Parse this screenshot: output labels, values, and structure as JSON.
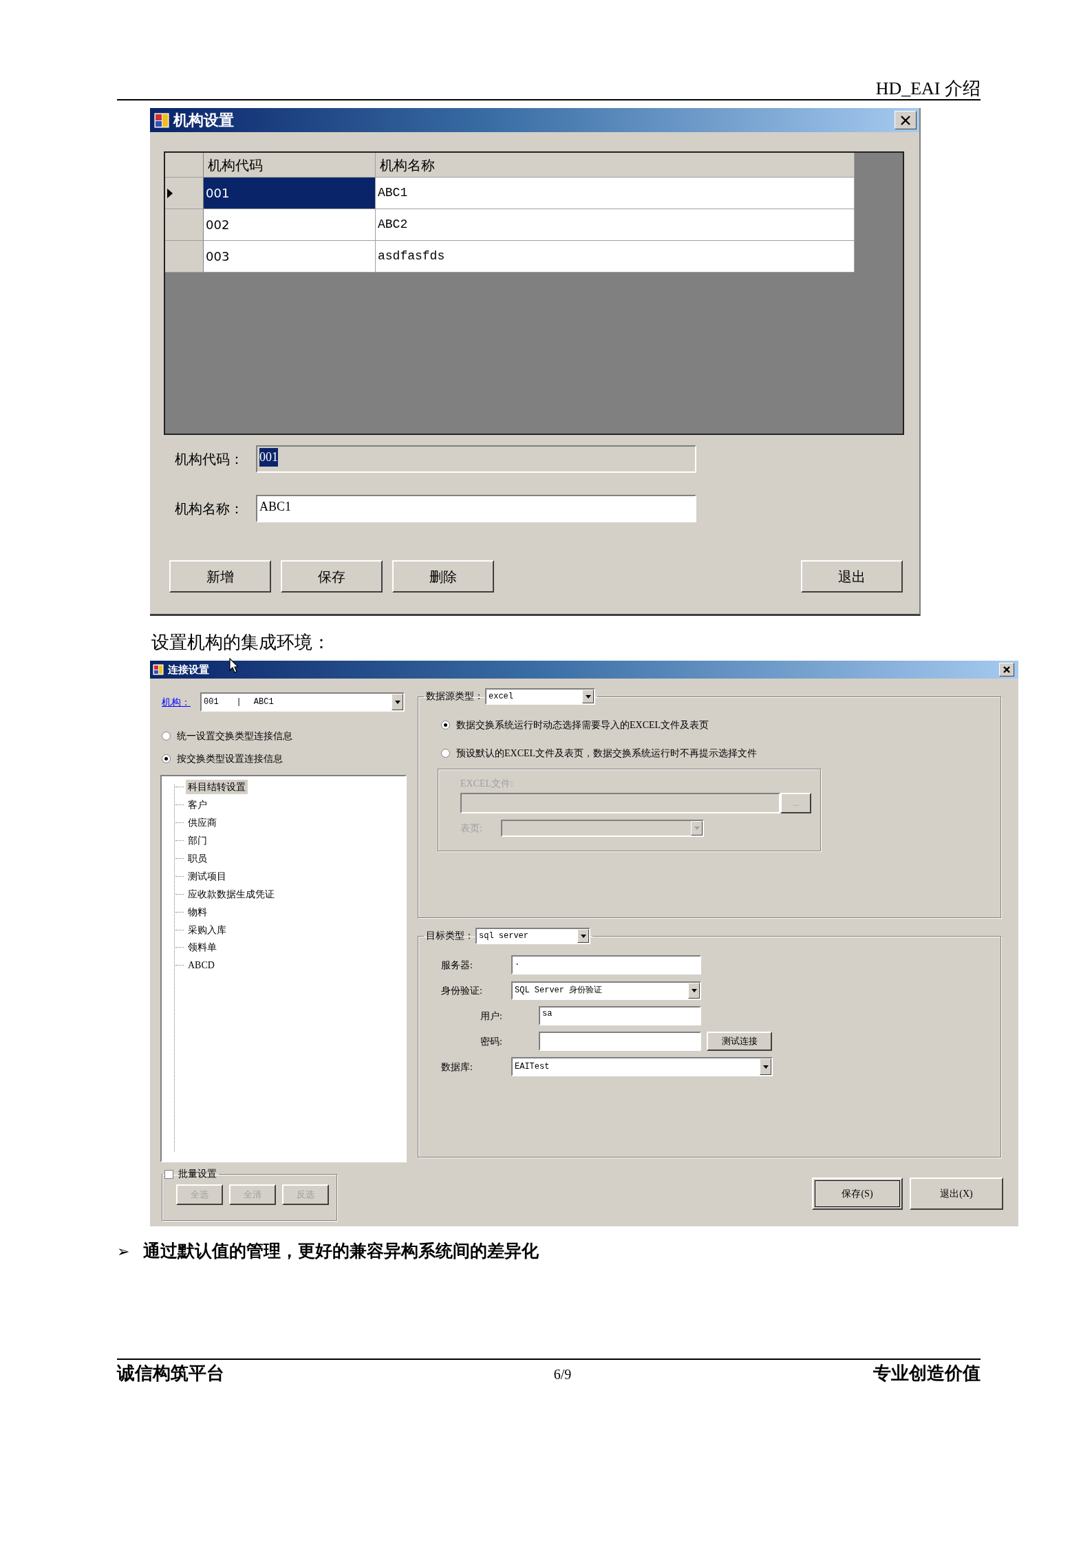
{
  "header": {
    "title": "HD_EAI 介绍"
  },
  "org_window": {
    "title": "机构设置",
    "columns": [
      "机构代码",
      "机构名称"
    ],
    "rows": [
      {
        "code": "001",
        "name": "ABC1",
        "selected": true
      },
      {
        "code": "002",
        "name": "ABC2",
        "selected": false
      },
      {
        "code": "003",
        "name": "asdfasfds",
        "selected": false
      }
    ],
    "fields": [
      {
        "label": "机构代码：",
        "value": "001",
        "disabled": true,
        "highlighted": true
      },
      {
        "label": "机构名称：",
        "value": "ABC1",
        "disabled": false,
        "highlighted": false
      }
    ],
    "buttons": [
      "新增",
      "保存",
      "删除"
    ],
    "exit_button": "退出"
  },
  "caption": "设置机构的集成环境：",
  "connection_window": {
    "title": "连接设置",
    "org": {
      "label": "机构：",
      "code": "001",
      "separator": "|",
      "name": "ABC1"
    },
    "modes": [
      {
        "label": "统一设置交换类型连接信息",
        "selected": false
      },
      {
        "label": "按交换类型设置连接信息",
        "selected": true
      }
    ],
    "tree": [
      {
        "label": "科目结转设置",
        "selected": true
      },
      {
        "label": "客户",
        "selected": false
      },
      {
        "label": "供应商",
        "selected": false
      },
      {
        "label": "部门",
        "selected": false
      },
      {
        "label": "职员",
        "selected": false
      },
      {
        "label": "测试项目",
        "selected": false
      },
      {
        "label": "应收款数据生成凭证",
        "selected": false
      },
      {
        "label": "物料",
        "selected": false
      },
      {
        "label": "采购入库",
        "selected": false
      },
      {
        "label": "领料单",
        "selected": false
      },
      {
        "label": "ABCD",
        "selected": false
      }
    ],
    "batch": {
      "label": "批量设置",
      "checked": false,
      "buttons": [
        "全选",
        "全清",
        "反选"
      ]
    },
    "source": {
      "label": "数据源类型：",
      "value": "excel",
      "options": [
        {
          "label": "数据交换系统运行时动态选择需要导入的EXCEL文件及表页",
          "selected": true
        },
        {
          "label": "预设默认的EXCEL文件及表页，数据交换系统运行时不再提示选择文件",
          "selected": false
        }
      ],
      "file_label": "EXCEL文件:",
      "browse": "...",
      "sheet_label": "表页:"
    },
    "target": {
      "label": "目标类型：",
      "value": "sql server",
      "fields": [
        {
          "kind": "text",
          "label": "服务器:",
          "value": "."
        },
        {
          "kind": "select",
          "label": "身份验证:",
          "value": "SQL Server 身份验证"
        },
        {
          "kind": "inset",
          "label": "用户:",
          "value": "sa"
        },
        {
          "kind": "password",
          "label": "密码:",
          "button": "测试连接"
        },
        {
          "kind": "wide_select",
          "label": "数据库:",
          "value": "EAITest"
        }
      ]
    },
    "save_button": "保存(S)",
    "exit_button": "退出(X)"
  },
  "bullet": {
    "mark": "➢",
    "text": "通过默认值的管理，更好的兼容异构系统间的差异化"
  },
  "footer": {
    "left": "诚信构筑平台",
    "page": "6/9",
    "right": "专业创造价值"
  }
}
